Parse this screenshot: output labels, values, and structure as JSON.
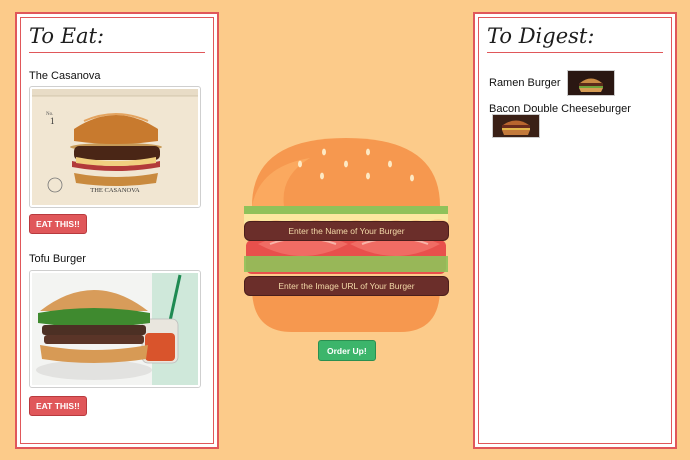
{
  "to_eat": {
    "title": "To Eat:",
    "items": [
      {
        "name": "The Casanova",
        "button_label": "EAT THIS!!",
        "photo_caption": "THE CASANOVA"
      },
      {
        "name": "Tofu Burger",
        "button_label": "EAT THIS!!"
      }
    ]
  },
  "to_digest": {
    "title": "To Digest:",
    "items": [
      {
        "name": "Ramen Burger"
      },
      {
        "name": "Bacon Double Cheeseburger"
      }
    ]
  },
  "form": {
    "name_placeholder": "Enter the Name of Your Burger",
    "image_placeholder": "Enter the Image URL of Your Burger",
    "submit_label": "Order Up!"
  },
  "colors": {
    "background": "#fccb8a",
    "accent": "#e0575a",
    "submit": "#3cb56b",
    "input": "#6b2e2a"
  }
}
